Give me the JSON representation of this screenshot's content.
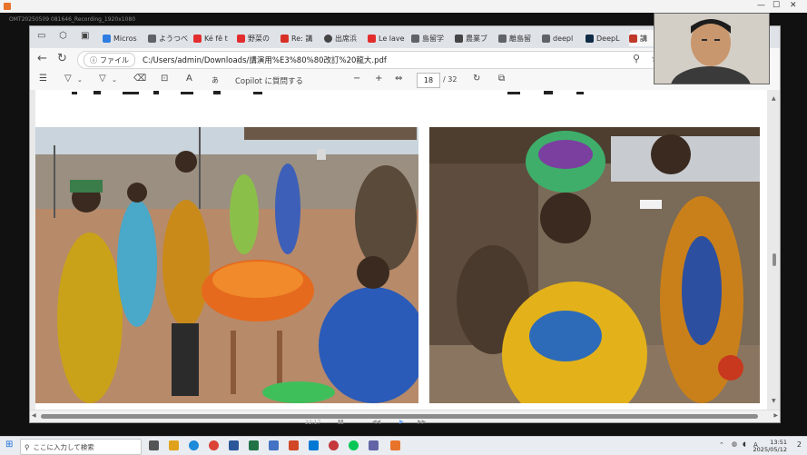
{
  "recorder": {
    "filename": "OMT20250509 081646_Recording_1920x1080",
    "controls": [
      "—",
      "☐",
      "✕"
    ]
  },
  "browser": {
    "tabs": [
      {
        "label": "Micros",
        "icon_color": "#2f7de1"
      },
      {
        "label": "ようつべ",
        "icon_color": "#5f6368"
      },
      {
        "label": "Ké fê t",
        "icon_color": "#e32d2d"
      },
      {
        "label": "野菜の",
        "icon_color": "#e32d2d"
      },
      {
        "label": "Re: 講",
        "icon_color": "#d93025"
      },
      {
        "label": "出席浜",
        "icon_color": "#444444"
      },
      {
        "label": "Le lave",
        "icon_color": "#e32d2d"
      },
      {
        "label": "島留学",
        "icon_color": "#5f6368"
      },
      {
        "label": "農業ブ",
        "icon_color": "#444444"
      },
      {
        "label": "離島留",
        "icon_color": "#5f6368"
      },
      {
        "label": "deepl",
        "icon_color": "#5f6368"
      },
      {
        "label": "DeepL",
        "icon_color": "#0f2b46"
      },
      {
        "label": "講",
        "icon_color": "#c0392b",
        "active": true
      }
    ],
    "address": {
      "scheme_label": "ファイル",
      "path": "C:/Users/admin/Downloads/講演用%E3%80%80改訂%20龍大.pdf"
    }
  },
  "pdf_toolbar": {
    "copilot_label": "Copilot に質問する",
    "zoom_out": "−",
    "zoom_in": "+",
    "current_page": "18",
    "total_pages": "/ 32"
  },
  "taskbar": {
    "search_placeholder": "ここに入力して検索",
    "time": "13:51",
    "date": "2025/05/12",
    "notification_count": "2",
    "language": "A"
  },
  "player": {
    "time": "22:17"
  },
  "colors": {
    "accent_recording": "#e8732a",
    "pdf_icon": "#c0392b"
  }
}
